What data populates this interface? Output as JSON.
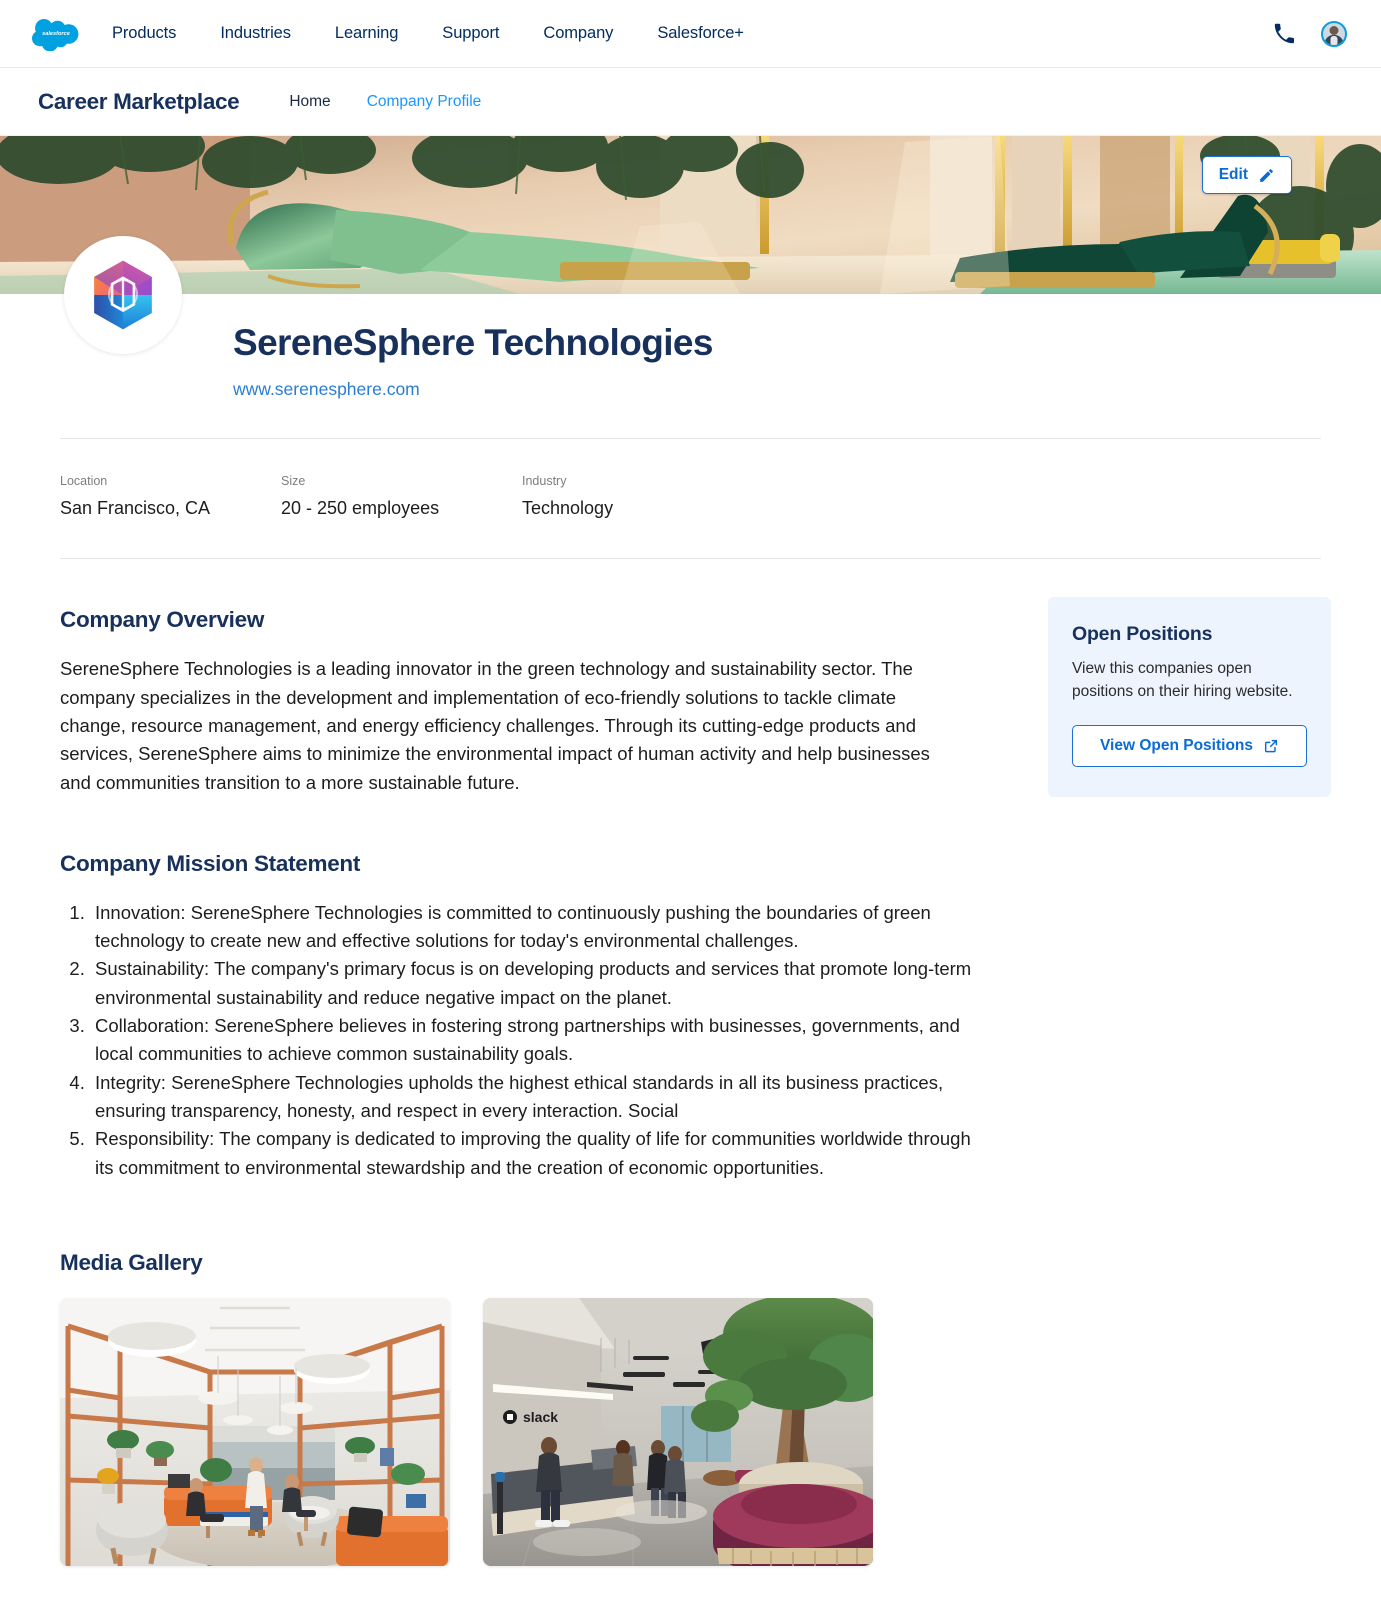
{
  "global_nav": {
    "logo_icon": "salesforce-cloud-logo",
    "links": [
      {
        "label": "Products"
      },
      {
        "label": "Industries"
      },
      {
        "label": "Learning"
      },
      {
        "label": "Support"
      },
      {
        "label": "Company"
      },
      {
        "label": "Salesforce+"
      }
    ],
    "phone_icon": "phone-icon",
    "avatar_icon": "user-avatar"
  },
  "app_nav": {
    "title": "Career Marketplace",
    "links": [
      {
        "label": "Home",
        "active": false
      },
      {
        "label": "Company Profile",
        "active": true
      }
    ]
  },
  "hero": {
    "edit_label": "Edit",
    "edit_icon": "pencil-icon",
    "banner_alt": "luxury-lounge-pool-banner"
  },
  "company": {
    "logo_icon": "serenesphere-hexagon-logo",
    "name": "SereneSphere Technologies",
    "website": "www.serenesphere.com",
    "meta": [
      {
        "label": "Location",
        "value": "San Francisco, CA"
      },
      {
        "label": "Size",
        "value": "20 - 250 employees"
      },
      {
        "label": "Industry",
        "value": "Technology"
      }
    ]
  },
  "overview": {
    "heading": "Company Overview",
    "body": "SereneSphere Technologies is a leading innovator in the green technology and sustainability sector. The company specializes in the development and implementation of eco-friendly solutions to tackle climate change, resource management, and energy efficiency challenges. Through its cutting-edge products and services, SereneSphere aims to minimize the environmental impact of human activity and help businesses and communities transition to a more sustainable future."
  },
  "mission": {
    "heading": "Company Mission Statement",
    "items": [
      "Innovation: SereneSphere Technologies is committed to continuously pushing the boundaries of green technology to create new and effective solutions for today's environmental challenges.",
      "Sustainability: The company's primary focus is on developing products and services that promote long-term environmental sustainability and reduce negative impact on the planet.",
      "Collaboration: SereneSphere believes in fostering strong partnerships with businesses, governments, and local communities to achieve common sustainability goals.",
      "Integrity: SereneSphere Technologies upholds the highest ethical standards in all its business practices, ensuring transparency, honesty, and respect in every interaction. Social",
      "Responsibility: The company is dedicated to improving the quality of life for communities worldwide through its commitment to environmental stewardship and the creation of economic opportunities."
    ]
  },
  "gallery": {
    "heading": "Media Gallery",
    "items": [
      {
        "alt": "office-lounge-wooden-frame-photo"
      },
      {
        "alt": "slack-office-lobby-photo"
      }
    ]
  },
  "open_positions": {
    "title": "Open Positions",
    "description": "View this companies open positions on their hiring website.",
    "button_label": "View Open Positions",
    "button_icon": "external-link-icon"
  },
  "colors": {
    "brand_navy": "#17315c",
    "link_blue": "#1b96ff",
    "action_blue": "#0b6bd6",
    "card_bg": "#eef4fd",
    "salesforce_blue": "#00a1e0"
  }
}
